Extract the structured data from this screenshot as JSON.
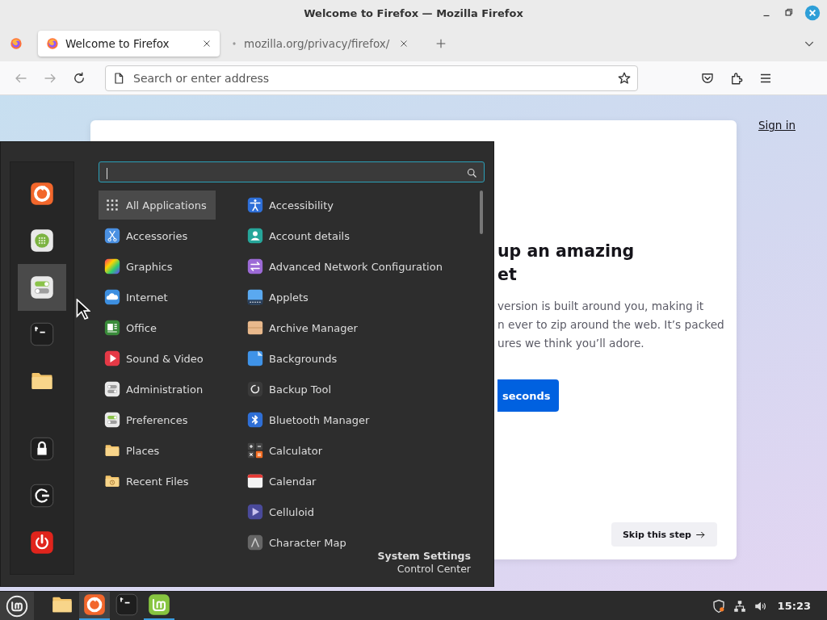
{
  "window": {
    "title": "Welcome to Firefox — Mozilla Firefox"
  },
  "tabs": [
    {
      "title": "Welcome to Firefox",
      "selected": true
    },
    {
      "title": "mozilla.org/privacy/firefox/",
      "selected": false
    }
  ],
  "address_bar": {
    "placeholder": "Search or enter address"
  },
  "page": {
    "sign_in": "Sign in",
    "headline": [
      "up an amazing",
      "et"
    ],
    "body": [
      "version is built around you, making it",
      "n ever to zip around the web. It’s packed",
      "ures we think you’ll adore."
    ],
    "primary_button": "seconds",
    "skip_button": "Skip this step"
  },
  "menu": {
    "favorites": [
      {
        "kind": "firefox",
        "selected": false
      },
      {
        "kind": "software",
        "selected": false
      },
      {
        "kind": "settings",
        "selected": true
      },
      {
        "kind": "terminal",
        "selected": false
      },
      {
        "kind": "folder",
        "selected": false
      }
    ],
    "session": [
      {
        "kind": "lock"
      },
      {
        "kind": "logout"
      },
      {
        "kind": "power"
      }
    ],
    "categories": [
      {
        "label": "All Applications",
        "kind": "grid",
        "selected": true
      },
      {
        "label": "Accessories",
        "kind": "accessories",
        "selected": false
      },
      {
        "label": "Graphics",
        "kind": "graphics",
        "selected": false
      },
      {
        "label": "Internet",
        "kind": "internet",
        "selected": false
      },
      {
        "label": "Office",
        "kind": "office",
        "selected": false
      },
      {
        "label": "Sound & Video",
        "kind": "sound",
        "selected": false
      },
      {
        "label": "Administration",
        "kind": "admin",
        "selected": false
      },
      {
        "label": "Preferences",
        "kind": "prefs",
        "selected": false
      },
      {
        "label": "Places",
        "kind": "folder",
        "selected": false
      },
      {
        "label": "Recent Files",
        "kind": "recent",
        "selected": false
      }
    ],
    "apps": [
      {
        "label": "Accessibility",
        "kind": "accessibility"
      },
      {
        "label": "Account details",
        "kind": "account"
      },
      {
        "label": "Advanced Network Configuration",
        "kind": "network"
      },
      {
        "label": "Applets",
        "kind": "applets"
      },
      {
        "label": "Archive Manager",
        "kind": "archive"
      },
      {
        "label": "Backgrounds",
        "kind": "backgrounds"
      },
      {
        "label": "Backup Tool",
        "kind": "backup"
      },
      {
        "label": "Bluetooth Manager",
        "kind": "bluetooth"
      },
      {
        "label": "Calculator",
        "kind": "calculator"
      },
      {
        "label": "Calendar",
        "kind": "calendar"
      },
      {
        "label": "Celluloid",
        "kind": "celluloid"
      },
      {
        "label": "Character Map",
        "kind": "charmap"
      }
    ],
    "footer": {
      "title": "System Settings",
      "subtitle": "Control Center"
    }
  },
  "taskbar": {
    "launchers": [
      {
        "kind": "folder",
        "running": false
      },
      {
        "kind": "firefox",
        "running": true
      },
      {
        "kind": "terminal",
        "running": false
      },
      {
        "kind": "mint",
        "running": true
      }
    ],
    "clock": "15:23"
  }
}
